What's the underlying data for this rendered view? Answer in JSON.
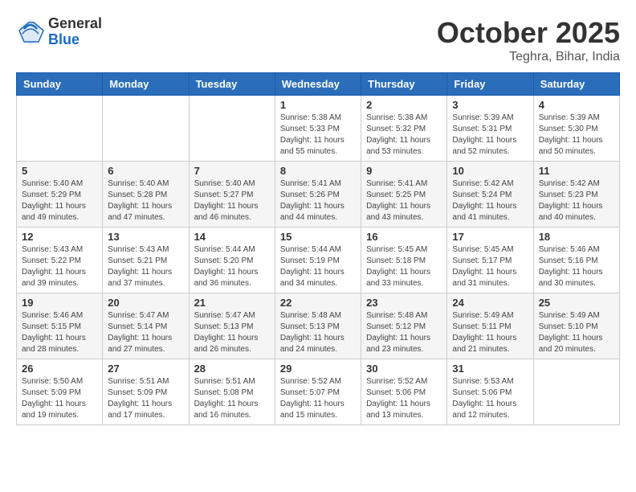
{
  "header": {
    "logo_general": "General",
    "logo_blue": "Blue",
    "month_title": "October 2025",
    "subtitle": "Teghra, Bihar, India"
  },
  "weekdays": [
    "Sunday",
    "Monday",
    "Tuesday",
    "Wednesday",
    "Thursday",
    "Friday",
    "Saturday"
  ],
  "weeks": [
    [
      {
        "day": "",
        "info": ""
      },
      {
        "day": "",
        "info": ""
      },
      {
        "day": "",
        "info": ""
      },
      {
        "day": "1",
        "info": "Sunrise: 5:38 AM\nSunset: 5:33 PM\nDaylight: 11 hours\nand 55 minutes."
      },
      {
        "day": "2",
        "info": "Sunrise: 5:38 AM\nSunset: 5:32 PM\nDaylight: 11 hours\nand 53 minutes."
      },
      {
        "day": "3",
        "info": "Sunrise: 5:39 AM\nSunset: 5:31 PM\nDaylight: 11 hours\nand 52 minutes."
      },
      {
        "day": "4",
        "info": "Sunrise: 5:39 AM\nSunset: 5:30 PM\nDaylight: 11 hours\nand 50 minutes."
      }
    ],
    [
      {
        "day": "5",
        "info": "Sunrise: 5:40 AM\nSunset: 5:29 PM\nDaylight: 11 hours\nand 49 minutes."
      },
      {
        "day": "6",
        "info": "Sunrise: 5:40 AM\nSunset: 5:28 PM\nDaylight: 11 hours\nand 47 minutes."
      },
      {
        "day": "7",
        "info": "Sunrise: 5:40 AM\nSunset: 5:27 PM\nDaylight: 11 hours\nand 46 minutes."
      },
      {
        "day": "8",
        "info": "Sunrise: 5:41 AM\nSunset: 5:26 PM\nDaylight: 11 hours\nand 44 minutes."
      },
      {
        "day": "9",
        "info": "Sunrise: 5:41 AM\nSunset: 5:25 PM\nDaylight: 11 hours\nand 43 minutes."
      },
      {
        "day": "10",
        "info": "Sunrise: 5:42 AM\nSunset: 5:24 PM\nDaylight: 11 hours\nand 41 minutes."
      },
      {
        "day": "11",
        "info": "Sunrise: 5:42 AM\nSunset: 5:23 PM\nDaylight: 11 hours\nand 40 minutes."
      }
    ],
    [
      {
        "day": "12",
        "info": "Sunrise: 5:43 AM\nSunset: 5:22 PM\nDaylight: 11 hours\nand 39 minutes."
      },
      {
        "day": "13",
        "info": "Sunrise: 5:43 AM\nSunset: 5:21 PM\nDaylight: 11 hours\nand 37 minutes."
      },
      {
        "day": "14",
        "info": "Sunrise: 5:44 AM\nSunset: 5:20 PM\nDaylight: 11 hours\nand 36 minutes."
      },
      {
        "day": "15",
        "info": "Sunrise: 5:44 AM\nSunset: 5:19 PM\nDaylight: 11 hours\nand 34 minutes."
      },
      {
        "day": "16",
        "info": "Sunrise: 5:45 AM\nSunset: 5:18 PM\nDaylight: 11 hours\nand 33 minutes."
      },
      {
        "day": "17",
        "info": "Sunrise: 5:45 AM\nSunset: 5:17 PM\nDaylight: 11 hours\nand 31 minutes."
      },
      {
        "day": "18",
        "info": "Sunrise: 5:46 AM\nSunset: 5:16 PM\nDaylight: 11 hours\nand 30 minutes."
      }
    ],
    [
      {
        "day": "19",
        "info": "Sunrise: 5:46 AM\nSunset: 5:15 PM\nDaylight: 11 hours\nand 28 minutes."
      },
      {
        "day": "20",
        "info": "Sunrise: 5:47 AM\nSunset: 5:14 PM\nDaylight: 11 hours\nand 27 minutes."
      },
      {
        "day": "21",
        "info": "Sunrise: 5:47 AM\nSunset: 5:13 PM\nDaylight: 11 hours\nand 26 minutes."
      },
      {
        "day": "22",
        "info": "Sunrise: 5:48 AM\nSunset: 5:13 PM\nDaylight: 11 hours\nand 24 minutes."
      },
      {
        "day": "23",
        "info": "Sunrise: 5:48 AM\nSunset: 5:12 PM\nDaylight: 11 hours\nand 23 minutes."
      },
      {
        "day": "24",
        "info": "Sunrise: 5:49 AM\nSunset: 5:11 PM\nDaylight: 11 hours\nand 21 minutes."
      },
      {
        "day": "25",
        "info": "Sunrise: 5:49 AM\nSunset: 5:10 PM\nDaylight: 11 hours\nand 20 minutes."
      }
    ],
    [
      {
        "day": "26",
        "info": "Sunrise: 5:50 AM\nSunset: 5:09 PM\nDaylight: 11 hours\nand 19 minutes."
      },
      {
        "day": "27",
        "info": "Sunrise: 5:51 AM\nSunset: 5:09 PM\nDaylight: 11 hours\nand 17 minutes."
      },
      {
        "day": "28",
        "info": "Sunrise: 5:51 AM\nSunset: 5:08 PM\nDaylight: 11 hours\nand 16 minutes."
      },
      {
        "day": "29",
        "info": "Sunrise: 5:52 AM\nSunset: 5:07 PM\nDaylight: 11 hours\nand 15 minutes."
      },
      {
        "day": "30",
        "info": "Sunrise: 5:52 AM\nSunset: 5:06 PM\nDaylight: 11 hours\nand 13 minutes."
      },
      {
        "day": "31",
        "info": "Sunrise: 5:53 AM\nSunset: 5:06 PM\nDaylight: 11 hours\nand 12 minutes."
      },
      {
        "day": "",
        "info": ""
      }
    ]
  ]
}
